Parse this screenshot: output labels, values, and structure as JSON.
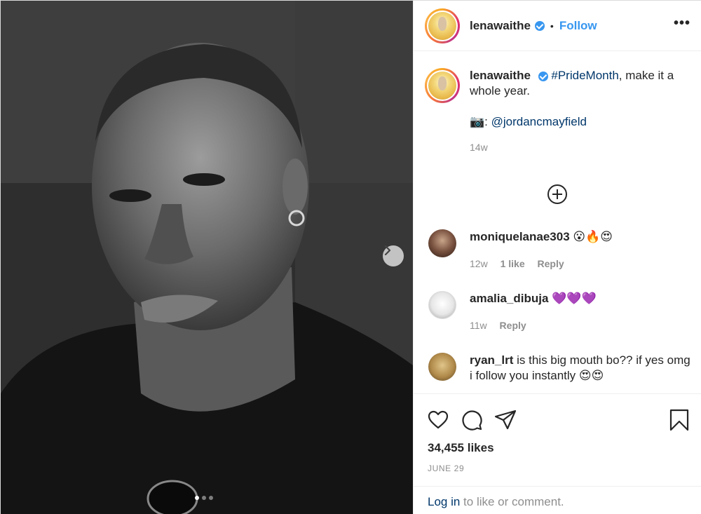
{
  "post": {
    "username": "lenawaithe",
    "follow_label": "Follow",
    "separator": "•",
    "more_label": "•••",
    "image_alt": "Black and white portrait photo",
    "carousel": {
      "total": 3,
      "current": 1
    },
    "caption": {
      "username": "lenawaithe",
      "hashtag": "#PrideMonth",
      "text_after_hashtag": ", make it a whole year.",
      "camera_emoji": "📷:",
      "mention": "@jordancmayfield",
      "age": "14w"
    },
    "comments": [
      {
        "username": "moniquelanae303",
        "text": "😮🔥😍",
        "age": "12w",
        "likes": "1 like",
        "reply": "Reply"
      },
      {
        "username": "amalia_dibuja",
        "text": "💜💜💜",
        "age": "11w",
        "reply": "Reply"
      },
      {
        "username": "ryan_lrt",
        "text": "is this big mouth bo?? if yes omg i follow you instantly 😍😍"
      }
    ],
    "likes": "34,455 likes",
    "date": "JUNE 29",
    "login_link": "Log in",
    "login_text": " to like or comment."
  },
  "colors": {
    "accent": "#3897f0",
    "link": "#00376b",
    "muted": "#8e8e8e"
  },
  "icons": [
    "heart-icon",
    "comment-icon",
    "share-icon",
    "bookmark-icon",
    "plus-circle-icon",
    "chevron-right-icon",
    "verified-badge-icon",
    "more-options-icon"
  ]
}
